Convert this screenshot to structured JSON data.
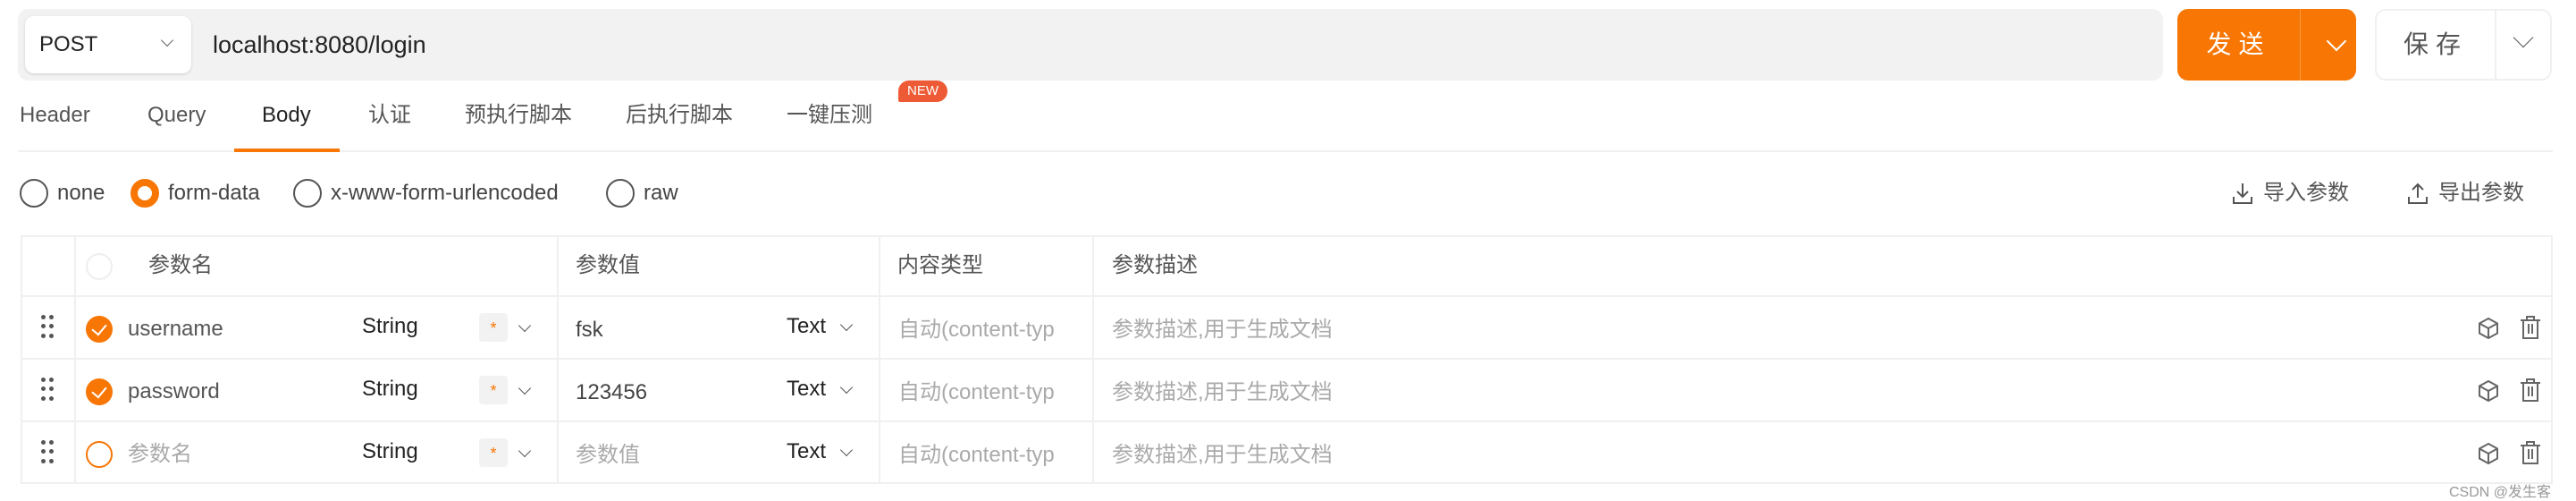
{
  "request": {
    "method": "POST",
    "url": "localhost:8080/login",
    "send_label": "发送",
    "save_label": "保存"
  },
  "tabs": [
    {
      "label": "Header"
    },
    {
      "label": "Query"
    },
    {
      "label": "Body",
      "active": true
    },
    {
      "label": "认证"
    },
    {
      "label": "预执行脚本"
    },
    {
      "label": "后执行脚本"
    },
    {
      "label": "一键压测",
      "badge": "NEW"
    }
  ],
  "body_types": [
    {
      "label": "none"
    },
    {
      "label": "form-data",
      "selected": true
    },
    {
      "label": "x-www-form-urlencoded"
    },
    {
      "label": "raw"
    }
  ],
  "actions": {
    "import_label": "导入参数",
    "export_label": "导出参数"
  },
  "table": {
    "headers": [
      "参数名",
      "参数值",
      "内容类型",
      "参数描述"
    ],
    "rows": [
      {
        "checked": true,
        "name": "username",
        "type": "String",
        "required": "*",
        "value": "fsk",
        "value_type": "Text",
        "content_type_placeholder": "自动(content-typ",
        "desc_placeholder": "参数描述,用于生成文档"
      },
      {
        "checked": true,
        "name": "password",
        "type": "String",
        "required": "*",
        "value": "123456",
        "value_type": "Text",
        "content_type_placeholder": "自动(content-typ",
        "desc_placeholder": "参数描述,用于生成文档"
      },
      {
        "checked": false,
        "name_placeholder": "参数名",
        "type": "String",
        "required": "*",
        "value_placeholder": "参数值",
        "value_type": "Text",
        "content_type_placeholder": "自动(content-typ",
        "desc_placeholder": "参数描述,用于生成文档"
      }
    ]
  },
  "watermark": "CSDN @发生客",
  "colors": {
    "accent": "#f77604",
    "badge": "#ee5a35",
    "url_bg": "#f2f2f2"
  }
}
